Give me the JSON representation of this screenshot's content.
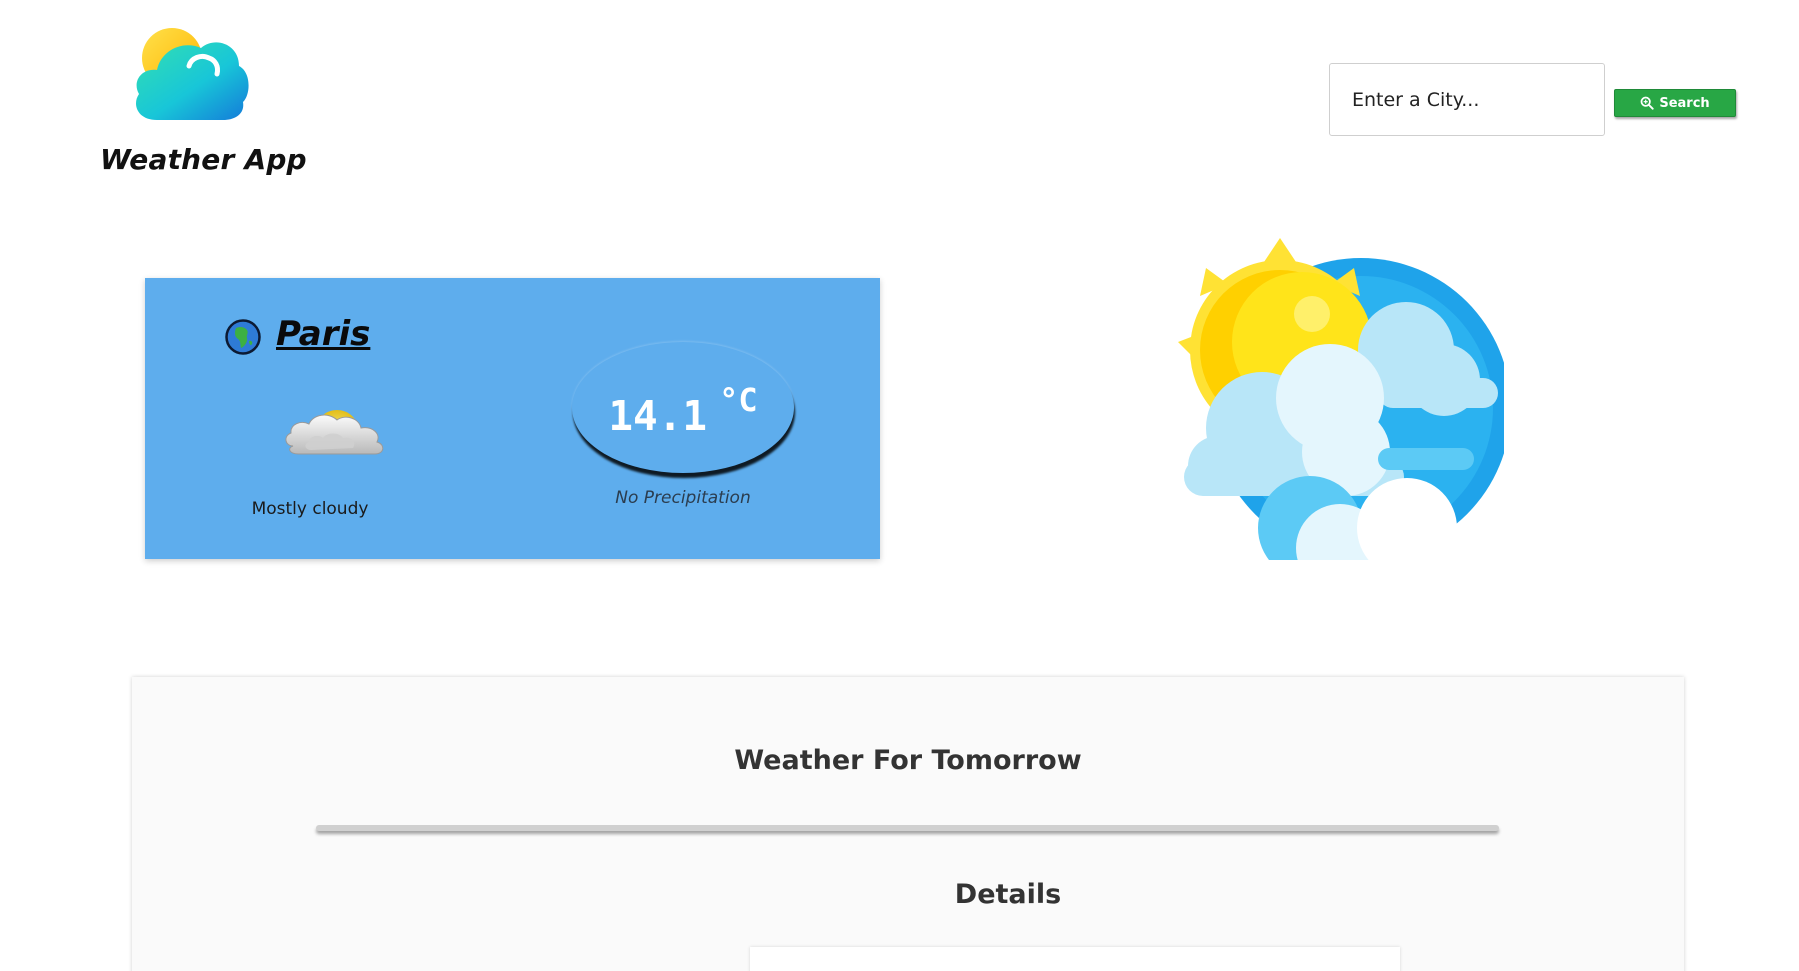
{
  "header": {
    "app_title": "Weather App",
    "logo_icon": "cloud-sun-logo-icon"
  },
  "search": {
    "placeholder": "Enter a City...",
    "button_label": "Search",
    "button_icon": "magnifier-icon",
    "button_color": "#28a745"
  },
  "current": {
    "city": "Paris",
    "city_icon": "globe-icon",
    "condition": "Mostly cloudy",
    "condition_icon": "mostly-cloudy-icon",
    "temperature": "14.1",
    "unit": "°C",
    "precipitation": "No Precipitation",
    "card_color": "#5eaded"
  },
  "hero": {
    "icon": "sun-behind-clouds-illustration"
  },
  "tomorrow": {
    "title": "Weather For Tomorrow",
    "details_title": "Details"
  }
}
